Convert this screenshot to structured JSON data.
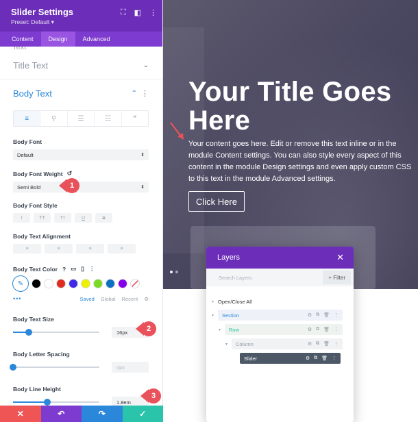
{
  "panel": {
    "title": "Slider Settings",
    "preset": "Preset: Default ▾",
    "tabs": [
      "Content",
      "Design",
      "Advanced"
    ],
    "ghost_label": "Text",
    "title_text_label": "Title Text",
    "body_text_label": "Body Text",
    "body_font_label": "Body Font",
    "body_font_value": "Default",
    "body_font_weight_label": "Body Font Weight",
    "body_font_weight_value": "Semi Bold",
    "body_font_style_label": "Body Font Style",
    "font_style_buttons": [
      "I",
      "TT",
      "Tт",
      "U",
      "S"
    ],
    "body_text_alignment_label": "Body Text Alignment",
    "body_text_color_label": "Body Text Color",
    "swatches": [
      "#000000",
      "#ffffff",
      "#e02b20",
      "#3f29e6",
      "#edf000",
      "#7cda24",
      "#0c71c3",
      "#8300e9"
    ],
    "palette_tabs": [
      "Saved",
      "Global",
      "Recent"
    ],
    "palette_more": "•••",
    "body_text_size_label": "Body Text Size",
    "body_text_size_value": "16px",
    "body_text_size_level": 0.18,
    "body_letter_spacing_label": "Body Letter Spacing",
    "body_letter_spacing_value": "0px",
    "body_letter_spacing_level": 0.0,
    "body_line_height_label": "Body Line Height",
    "body_line_height_value": "1.8em",
    "body_line_height_level": 0.4,
    "callouts": [
      "1",
      "2",
      "3"
    ],
    "footer_colors": [
      "#ef5555",
      "#7e3bd0",
      "#2b87da",
      "#29c4a9"
    ]
  },
  "hero": {
    "title": "Your Title Goes Here",
    "body": "Your content goes here. Edit or remove this text inline or in the module Content settings. You can also style every aspect of this content in the module Design settings and even apply custom CSS to this text in the module Advanced settings.",
    "button": "Click Here"
  },
  "layers": {
    "title": "Layers",
    "search_placeholder": "Search Layers",
    "filter_label": "+ Filter",
    "toggle_label": "Open/Close All",
    "section_label": "Section",
    "row_label": "Row",
    "column_label": "Column",
    "slider_label": "Slider"
  },
  "accent_color": "#6c2eb9",
  "link_color": "#2b87da"
}
